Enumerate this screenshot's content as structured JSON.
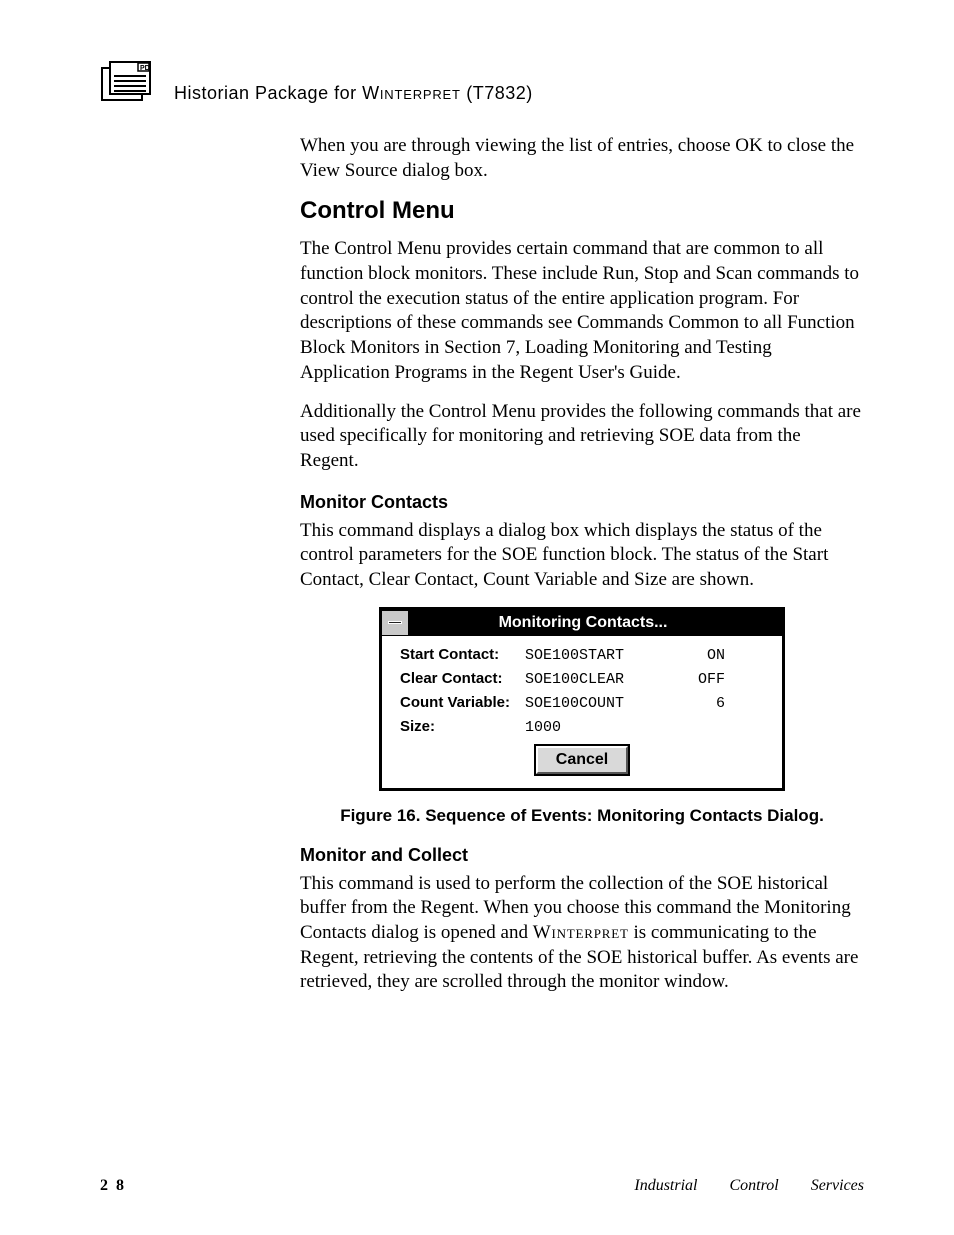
{
  "header": {
    "title_pre": "Historian Package for ",
    "title_sc": "Winterpret",
    "title_post": " (T7832)"
  },
  "paragraphs": {
    "intro1": "When you are through viewing the list of entries, choose OK to close the View Source dialog box.",
    "control_heading": "Control Menu",
    "control_p1": "The Control Menu provides certain command that are common to all function block monitors.  These include Run, Stop and Scan commands to control the execution status of the entire application program.  For descriptions of these commands see Commands Common to all Function Block Monitors in Section 7, Loading Monitoring and Testing Application Programs in the Regent User's Guide.",
    "control_p2": "Additionally the Control Menu provides the following commands that are used specifically for monitoring and retrieving SOE data from the Regent.",
    "mc_heading": "Monitor Contacts",
    "mc_p1": "This command displays a dialog box which displays the status of the control parameters for the SOE function block.  The status of the Start Contact, Clear Contact, Count Variable and Size are shown.",
    "mac_heading": "Monitor and Collect",
    "mac_p1_a": "This command is used to perform the collection of the SOE historical buffer from the Regent.  When you choose this command the Monitoring Contacts dialog is opened and ",
    "mac_p1_sc": "Winterpret",
    "mac_p1_b": " is communicating to the Regent, retrieving the contents of the SOE historical buffer.  As events are retrieved, they are scrolled through the monitor window."
  },
  "dialog": {
    "title": "Monitoring Contacts...",
    "rows": [
      {
        "label": "Start Contact:",
        "value": "SOE100START",
        "state": "ON"
      },
      {
        "label": "Clear Contact:",
        "value": "SOE100CLEAR",
        "state": "OFF"
      },
      {
        "label": "Count Variable:",
        "value": "SOE100COUNT",
        "state": "6"
      },
      {
        "label": "Size:",
        "value": "1000",
        "state": ""
      }
    ],
    "cancel": "Cancel"
  },
  "figure_caption": "Figure 16.  Sequence of Events: Monitoring Contacts Dialog.",
  "footer": {
    "page": "2 8",
    "right": "Industrial Control Services"
  }
}
